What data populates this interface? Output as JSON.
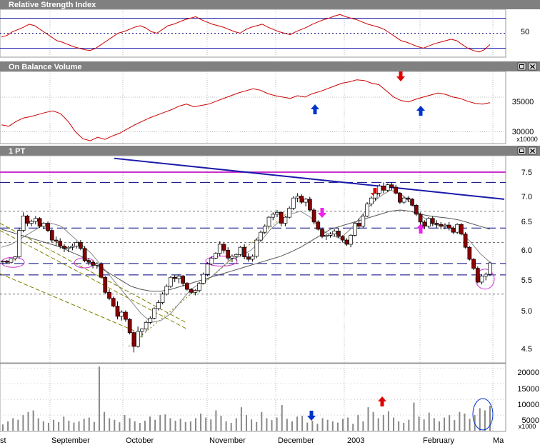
{
  "panels": {
    "rsi": {
      "title": "Relative Strength Index",
      "ticks": [
        "50"
      ]
    },
    "obv": {
      "title": "On Balance Volume",
      "ticks": [
        "35000",
        "30000"
      ],
      "unit": "x10000"
    },
    "price": {
      "title": "1 PT",
      "ticks": [
        "7.5",
        "7.0",
        "6.5",
        "6.0",
        "5.5",
        "5.0",
        "4.5"
      ]
    },
    "volume": {
      "ticks": [
        "20000",
        "15000",
        "10000",
        "5000"
      ],
      "unit": "x1000"
    }
  },
  "x_labels": [
    "st",
    "September",
    "October",
    "November",
    "December",
    "2003",
    "February",
    "Ma"
  ],
  "colors": {
    "rsi_line": "#cc0000",
    "obv_line": "#cc0000",
    "resistance": "#cc33cc",
    "trendline": "#1a1aaa",
    "dashed_level": "#000080",
    "bull": "#ffffff",
    "bear": "#8b0000",
    "arrow_red": "#e00000",
    "arrow_blue": "#0033cc",
    "arrow_magenta": "#ee22ee",
    "panel_header": "#808080"
  },
  "icons": [
    "maximize-icon",
    "close-icon"
  ],
  "chart_data": {
    "type": "candlestick",
    "x": [
      "Aug",
      "Sep",
      "Oct",
      "Nov",
      "Dec",
      "2003",
      "Feb",
      "Mar"
    ],
    "price": {
      "ylim": [
        4.3,
        7.7
      ],
      "horizontal_levels": [
        7.45,
        7.28,
        6.8,
        6.52,
        6.28,
        5.93,
        5.74,
        5.42
      ],
      "resistance_line": 7.45,
      "downtrend_line": {
        "from": [
          160,
          7.68
        ],
        "to": [
          706,
          7.0
        ]
      },
      "bars": [
        [
          5.96,
          5.98,
          5.92,
          5.97
        ],
        [
          5.97,
          5.99,
          5.93,
          5.95
        ],
        [
          5.95,
          6.02,
          5.93,
          6.01
        ],
        [
          6.01,
          6.05,
          5.98,
          6.04
        ],
        [
          6.04,
          6.52,
          6.02,
          6.48
        ],
        [
          6.48,
          6.78,
          6.45,
          6.72
        ],
        [
          6.72,
          6.74,
          6.55,
          6.6
        ],
        [
          6.6,
          6.66,
          6.55,
          6.63
        ],
        [
          6.63,
          6.72,
          6.58,
          6.68
        ],
        [
          6.68,
          6.7,
          6.52,
          6.55
        ],
        [
          6.55,
          6.62,
          6.5,
          6.6
        ],
        [
          6.6,
          6.63,
          6.45,
          6.48
        ],
        [
          6.48,
          6.5,
          6.28,
          6.32
        ],
        [
          6.32,
          6.38,
          6.22,
          6.3
        ],
        [
          6.3,
          6.35,
          6.18,
          6.22
        ],
        [
          6.22,
          6.25,
          6.12,
          6.18
        ],
        [
          6.18,
          6.22,
          6.12,
          6.2
        ],
        [
          6.2,
          6.26,
          6.15,
          6.22
        ],
        [
          6.22,
          6.3,
          6.18,
          6.28
        ],
        [
          6.28,
          6.32,
          6.15,
          6.18
        ],
        [
          6.18,
          6.22,
          5.95,
          5.98
        ],
        [
          5.98,
          6.02,
          5.9,
          5.95
        ],
        [
          5.95,
          5.98,
          5.85,
          5.9
        ],
        [
          5.9,
          5.95,
          5.84,
          5.92
        ],
        [
          5.92,
          5.95,
          5.68,
          5.7
        ],
        [
          5.7,
          5.72,
          5.42,
          5.45
        ],
        [
          5.45,
          5.5,
          5.32,
          5.35
        ],
        [
          5.35,
          5.38,
          5.2,
          5.22
        ],
        [
          5.22,
          5.3,
          5.0,
          5.05
        ],
        [
          5.05,
          5.15,
          4.98,
          5.12
        ],
        [
          5.12,
          5.15,
          4.96,
          5.0
        ],
        [
          5.0,
          5.02,
          4.75,
          4.78
        ],
        [
          4.78,
          4.8,
          4.45,
          4.55
        ],
        [
          4.55,
          4.88,
          4.53,
          4.8
        ],
        [
          4.8,
          4.85,
          4.7,
          4.84
        ],
        [
          4.84,
          4.98,
          4.8,
          4.95
        ],
        [
          4.95,
          5.05,
          4.92,
          5.02
        ],
        [
          5.02,
          5.2,
          5.0,
          5.18
        ],
        [
          5.18,
          5.32,
          5.15,
          5.28
        ],
        [
          5.28,
          5.45,
          5.25,
          5.42
        ],
        [
          5.42,
          5.58,
          5.4,
          5.55
        ],
        [
          5.55,
          5.72,
          5.52,
          5.7
        ],
        [
          5.7,
          5.74,
          5.62,
          5.68
        ],
        [
          5.68,
          5.75,
          5.6,
          5.72
        ],
        [
          5.72,
          5.74,
          5.55,
          5.6
        ],
        [
          5.6,
          5.62,
          5.48,
          5.5
        ],
        [
          5.5,
          5.52,
          5.42,
          5.45
        ],
        [
          5.45,
          5.5,
          5.4,
          5.48
        ],
        [
          5.48,
          5.62,
          5.45,
          5.6
        ],
        [
          5.6,
          5.78,
          5.58,
          5.75
        ],
        [
          5.75,
          5.95,
          5.72,
          5.92
        ],
        [
          5.92,
          6.05,
          5.9,
          6.02
        ],
        [
          6.02,
          6.12,
          6.0,
          6.1
        ],
        [
          6.1,
          6.3,
          6.05,
          6.25
        ],
        [
          6.25,
          6.28,
          6.1,
          6.15
        ],
        [
          6.15,
          6.2,
          5.98,
          6.02
        ],
        [
          6.02,
          6.08,
          5.95,
          6.05
        ],
        [
          6.05,
          6.1,
          5.98,
          6.08
        ],
        [
          6.08,
          6.22,
          6.05,
          6.2
        ],
        [
          6.2,
          6.25,
          6.0,
          6.04
        ],
        [
          6.04,
          6.1,
          5.96,
          6.0
        ],
        [
          6.0,
          6.08,
          5.96,
          6.05
        ],
        [
          6.05,
          6.35,
          6.02,
          6.32
        ],
        [
          6.32,
          6.48,
          6.3,
          6.45
        ],
        [
          6.45,
          6.58,
          6.42,
          6.55
        ],
        [
          6.55,
          6.72,
          6.52,
          6.7
        ],
        [
          6.7,
          6.78,
          6.65,
          6.75
        ],
        [
          6.75,
          6.82,
          6.7,
          6.78
        ],
        [
          6.78,
          6.8,
          6.55,
          6.6
        ],
        [
          6.6,
          6.72,
          6.55,
          6.7
        ],
        [
          6.7,
          6.88,
          6.68,
          6.85
        ],
        [
          6.85,
          7.05,
          6.82,
          7.02
        ],
        [
          7.02,
          7.1,
          6.95,
          7.05
        ],
        [
          7.05,
          7.08,
          6.92,
          6.95
        ],
        [
          6.95,
          7.02,
          6.88,
          7.0
        ],
        [
          7.0,
          7.04,
          6.8,
          6.82
        ],
        [
          6.82,
          6.85,
          6.58,
          6.62
        ],
        [
          6.62,
          6.65,
          6.48,
          6.5
        ],
        [
          6.5,
          6.52,
          6.35,
          6.38
        ],
        [
          6.38,
          6.42,
          6.32,
          6.4
        ],
        [
          6.4,
          6.45,
          6.36,
          6.42
        ],
        [
          6.42,
          6.5,
          6.38,
          6.47
        ],
        [
          6.47,
          6.52,
          6.35,
          6.38
        ],
        [
          6.38,
          6.4,
          6.28,
          6.32
        ],
        [
          6.32,
          6.35,
          6.22,
          6.25
        ],
        [
          6.25,
          6.42,
          6.2,
          6.4
        ],
        [
          6.4,
          6.62,
          6.38,
          6.6
        ],
        [
          6.6,
          6.68,
          6.5,
          6.55
        ],
        [
          6.55,
          6.75,
          6.52,
          6.72
        ],
        [
          6.72,
          6.95,
          6.7,
          6.92
        ],
        [
          6.92,
          7.05,
          6.88,
          7.02
        ],
        [
          7.02,
          7.12,
          6.98,
          7.1
        ],
        [
          7.1,
          7.25,
          7.05,
          7.22
        ],
        [
          7.22,
          7.28,
          7.1,
          7.15
        ],
        [
          7.15,
          7.26,
          7.12,
          7.24
        ],
        [
          7.24,
          7.28,
          7.15,
          7.2
        ],
        [
          7.2,
          7.24,
          7.08,
          7.1
        ],
        [
          7.1,
          7.12,
          6.92,
          6.95
        ],
        [
          6.95,
          7.05,
          6.92,
          7.02
        ],
        [
          7.02,
          7.05,
          6.95,
          7.0
        ],
        [
          7.0,
          7.02,
          6.88,
          6.9
        ],
        [
          6.9,
          6.92,
          6.72,
          6.75
        ],
        [
          6.75,
          6.78,
          6.58,
          6.62
        ],
        [
          6.62,
          6.65,
          6.5,
          6.55
        ],
        [
          6.55,
          6.7,
          6.52,
          6.68
        ],
        [
          6.68,
          6.72,
          6.55,
          6.6
        ],
        [
          6.6,
          6.65,
          6.52,
          6.58
        ],
        [
          6.58,
          6.62,
          6.5,
          6.55
        ],
        [
          6.55,
          6.6,
          6.5,
          6.57
        ],
        [
          6.57,
          6.62,
          6.48,
          6.52
        ],
        [
          6.52,
          6.55,
          6.42,
          6.45
        ],
        [
          6.45,
          6.6,
          6.42,
          6.58
        ],
        [
          6.58,
          6.6,
          6.4,
          6.42
        ],
        [
          6.42,
          6.45,
          6.18,
          6.2
        ],
        [
          6.2,
          6.22,
          5.98,
          6.0
        ],
        [
          6.0,
          6.02,
          5.82,
          5.85
        ],
        [
          5.85,
          5.88,
          5.6,
          5.62
        ],
        [
          5.62,
          5.75,
          5.58,
          5.72
        ],
        [
          5.72,
          5.78,
          5.65,
          5.75
        ],
        [
          5.75,
          5.96,
          5.72,
          5.94
        ]
      ]
    },
    "moving_average_fast": [
      6.2,
      6.25,
      6.35,
      6.45,
      6.55,
      6.6,
      6.55,
      6.4,
      6.25,
      6.1,
      5.9,
      5.7,
      5.5,
      5.3,
      5.1,
      4.95,
      4.98,
      5.1,
      5.3,
      5.5,
      5.6,
      5.7,
      5.85,
      6.0,
      6.05,
      6.15,
      6.3,
      6.5,
      6.65,
      6.75,
      6.8,
      6.7,
      6.5,
      6.4,
      6.35,
      6.5,
      6.7,
      6.9,
      7.05,
      7.15,
      7.1,
      6.95,
      6.75,
      6.6,
      6.55,
      6.55,
      6.45,
      6.3,
      6.1,
      5.95
    ],
    "moving_average_slow": [
      6.5,
      6.45,
      6.4,
      6.35,
      6.3,
      6.25,
      6.2,
      6.12,
      6.05,
      5.95,
      5.85,
      5.75,
      5.65,
      5.55,
      5.5,
      5.47,
      5.47,
      5.5,
      5.55,
      5.6,
      5.65,
      5.7,
      5.75,
      5.8,
      5.85,
      5.9,
      5.95,
      6.0,
      6.05,
      6.12,
      6.2,
      6.3,
      6.4,
      6.5,
      6.55,
      6.6,
      6.65,
      6.7,
      6.75,
      6.8,
      6.82,
      6.8,
      6.75,
      6.72,
      6.7,
      6.68,
      6.65,
      6.6,
      6.55,
      6.5
    ],
    "rsi": {
      "ylim": [
        20,
        80
      ],
      "levels": [
        70,
        30
      ],
      "mid": 50,
      "values": [
        45,
        47,
        52,
        55,
        58,
        62,
        60,
        55,
        50,
        45,
        40,
        38,
        35,
        32,
        30,
        28,
        27,
        30,
        35,
        40,
        45,
        50,
        52,
        55,
        58,
        60,
        57,
        52,
        50,
        55,
        60,
        62,
        65,
        68,
        70,
        72,
        68,
        65,
        62,
        60,
        58,
        55,
        52,
        50,
        55,
        58,
        60,
        62,
        58,
        55,
        52,
        50,
        48,
        52,
        55,
        58,
        62,
        65,
        68,
        70,
        73,
        75,
        72,
        70,
        68,
        65,
        62,
        60,
        58,
        55,
        50,
        45,
        40,
        38,
        35,
        32,
        30,
        33,
        36,
        38,
        40,
        42,
        40,
        35,
        30,
        27,
        25,
        28,
        35
      ]
    },
    "obv": {
      "ylim": [
        28500,
        38500
      ],
      "values": [
        31000,
        30800,
        31500,
        32000,
        32200,
        32500,
        32800,
        33000,
        32600,
        31500,
        30000,
        29000,
        28700,
        29200,
        28900,
        29400,
        29800,
        30400,
        31000,
        31500,
        32000,
        32400,
        32800,
        33200,
        33700,
        34000,
        33600,
        33800,
        34000,
        34400,
        34800,
        35200,
        35600,
        35900,
        36200,
        36000,
        35500,
        35200,
        35000,
        34800,
        35200,
        35000,
        35500,
        35800,
        36200,
        36600,
        37000,
        37200,
        37500,
        37400,
        37000,
        36800,
        35900,
        35000,
        34500,
        34300,
        34700,
        35000,
        35300,
        35600,
        35400,
        35000,
        34800,
        34400,
        34100,
        34000,
        34200
      ]
    },
    "volume": {
      "ylim": [
        0,
        21000
      ],
      "values": [
        2000,
        3000,
        4000,
        3500,
        5000,
        6000,
        6500,
        4000,
        3000,
        2500,
        3500,
        2800,
        4500,
        3200,
        2600,
        3000,
        3800,
        4200,
        2800,
        20500,
        6000,
        4000,
        3500,
        2700,
        5000,
        4000,
        3000,
        2500,
        3200,
        4500,
        3500,
        5000,
        5200,
        4000,
        3200,
        3800,
        2800,
        3000,
        4000,
        5500,
        4200,
        3600,
        6500,
        4800,
        3000,
        2500,
        4000,
        7500,
        5000,
        3600,
        2800,
        6000,
        4000,
        3400,
        4200,
        8200,
        3800,
        3000,
        4500,
        4800,
        2600,
        3200,
        2200,
        4000,
        3500,
        3000,
        2600,
        3800,
        4200,
        2200,
        5000,
        3000,
        7500,
        6000,
        4000,
        5000,
        6200,
        4200,
        3000,
        2500,
        3500,
        9000,
        4500,
        3600,
        5800,
        4000,
        3000,
        4200,
        5000,
        3400,
        6000,
        5500,
        3800,
        5000,
        7200,
        6500,
        8000
      ]
    }
  }
}
